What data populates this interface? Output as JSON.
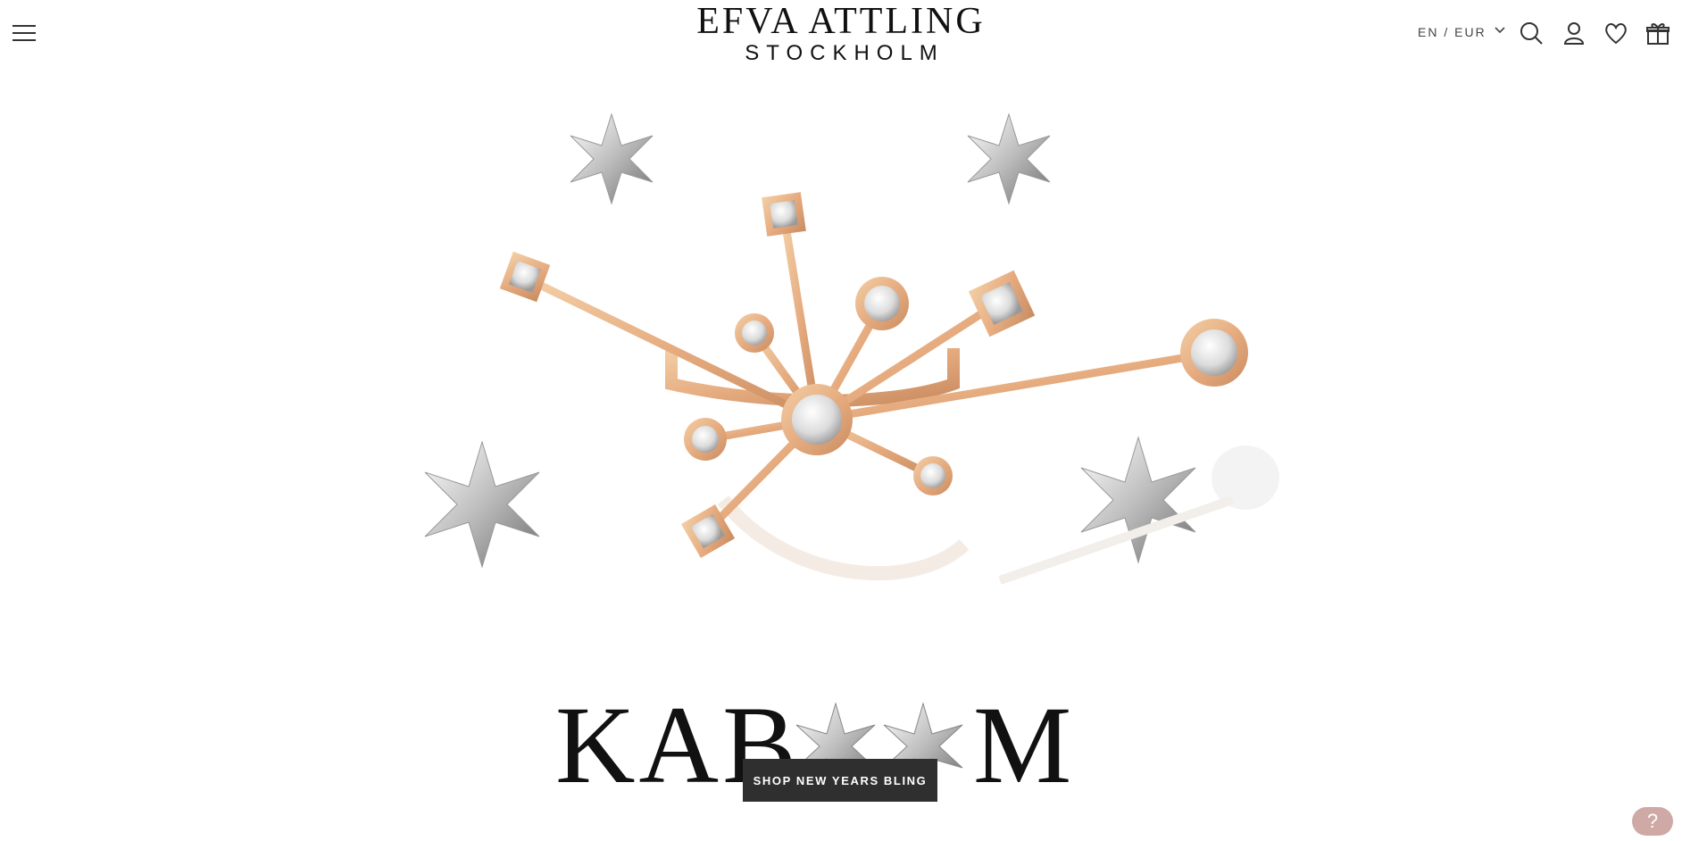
{
  "header": {
    "menu_icon": "hamburger-menu-icon",
    "logo_line1": "EFVA ATTLING",
    "logo_line2": "STOCKHOLM",
    "locale": "EN / EUR",
    "icons": [
      "search-icon",
      "account-icon",
      "wishlist-heart-icon",
      "gift-bag-icon"
    ]
  },
  "hero": {
    "headline_part1": "KAB",
    "headline_part2": "M",
    "cta_label": "SHOP NEW YEARS BLING"
  },
  "help": {
    "label": "?"
  },
  "colors": {
    "gold": "#e8b48a",
    "cta_bg": "#2f2f2f",
    "help_bg": "#cfa9a6"
  }
}
